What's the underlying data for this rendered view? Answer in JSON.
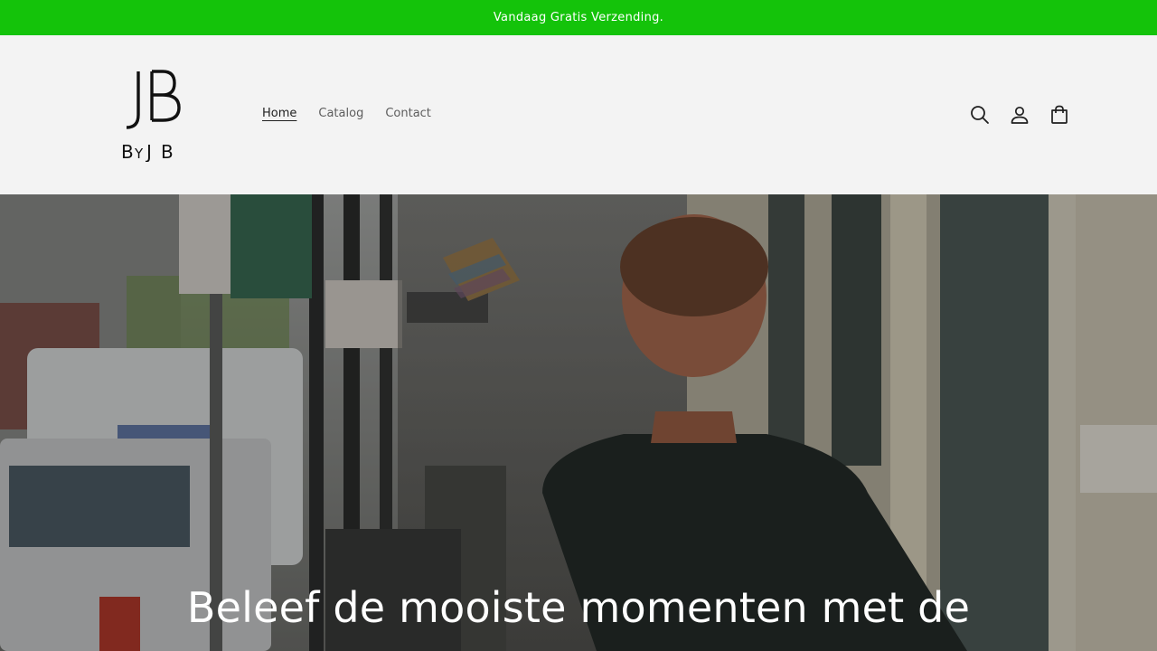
{
  "announcement": {
    "text": "Vandaag Gratis Verzending.",
    "background": "#14c30a"
  },
  "header": {
    "logo": {
      "monogram": "JB",
      "wordmark": "ByJB"
    },
    "nav": [
      {
        "label": "Home",
        "active": true
      },
      {
        "label": "Catalog",
        "active": false
      },
      {
        "label": "Contact",
        "active": false
      }
    ],
    "icons": [
      "search-icon",
      "account-icon",
      "cart-icon"
    ]
  },
  "hero": {
    "heading": "Beleef de mooiste momenten met de"
  },
  "colors": {
    "accent_green": "#14c30a",
    "header_bg": "#f3f3f3",
    "text_dark": "#1f1f1f",
    "text_muted": "#5d5d5d"
  }
}
